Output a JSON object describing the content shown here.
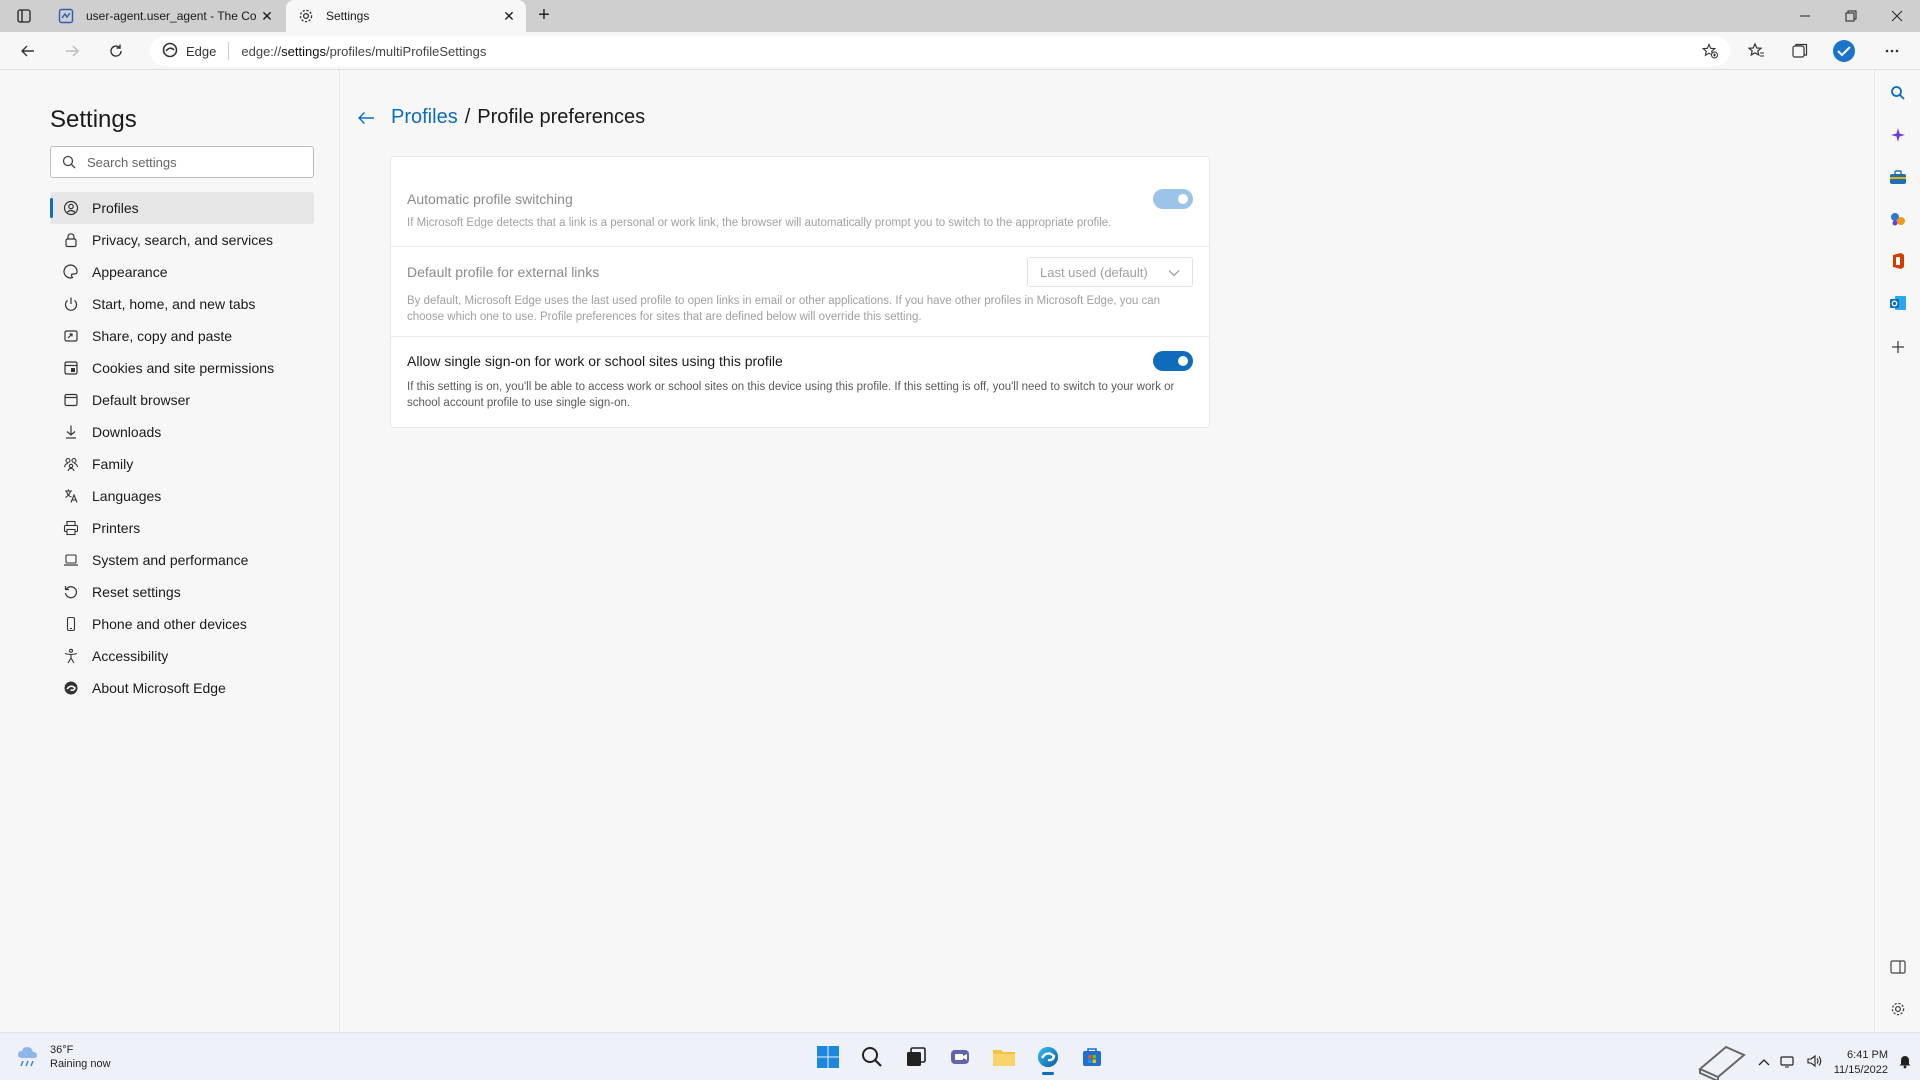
{
  "browser": {
    "tabs": [
      {
        "title": "user-agent.user_agent - The Coll",
        "active": false
      },
      {
        "title": "Settings",
        "active": true
      }
    ],
    "address": {
      "site_label": "Edge",
      "url_prefix": "edge://",
      "url_host": "settings",
      "url_path": "/profiles/multiProfileSettings"
    }
  },
  "sidebar": {
    "title": "Settings",
    "search_placeholder": "Search settings",
    "items": [
      {
        "label": "Profiles",
        "icon": "profile-icon",
        "selected": true
      },
      {
        "label": "Privacy, search, and services",
        "icon": "lock-icon"
      },
      {
        "label": "Appearance",
        "icon": "appearance-icon"
      },
      {
        "label": "Start, home, and new tabs",
        "icon": "power-icon"
      },
      {
        "label": "Share, copy and paste",
        "icon": "share-icon"
      },
      {
        "label": "Cookies and site permissions",
        "icon": "cookies-icon"
      },
      {
        "label": "Default browser",
        "icon": "browser-icon"
      },
      {
        "label": "Downloads",
        "icon": "download-icon"
      },
      {
        "label": "Family",
        "icon": "family-icon"
      },
      {
        "label": "Languages",
        "icon": "language-icon"
      },
      {
        "label": "Printers",
        "icon": "printer-icon"
      },
      {
        "label": "System and performance",
        "icon": "laptop-icon"
      },
      {
        "label": "Reset settings",
        "icon": "reset-icon"
      },
      {
        "label": "Phone and other devices",
        "icon": "phone-icon"
      },
      {
        "label": "Accessibility",
        "icon": "accessibility-icon"
      },
      {
        "label": "About Microsoft Edge",
        "icon": "edge-icon"
      }
    ]
  },
  "page": {
    "breadcrumb_parent": "Profiles",
    "breadcrumb_sep": "/",
    "title": "Profile preferences",
    "settings": [
      {
        "title": "Automatic profile switching",
        "description": "If Microsoft Edge detects that a link is a personal or work link, the browser will automatically prompt you to switch to the appropriate profile.",
        "control": "toggle",
        "on": true,
        "disabled": true
      },
      {
        "title": "Default profile for external links",
        "description": "By default, Microsoft Edge uses the last used profile to open links in email or other applications. If you have other profiles in Microsoft Edge, you can choose which one to use. Profile preferences for sites that are defined below will override this setting.",
        "control": "dropdown",
        "value": "Last used (default)",
        "disabled": true
      },
      {
        "title": "Allow single sign-on for work or school sites using this profile",
        "description": "If this setting is on, you'll be able to access work or school sites on this device using this profile. If this setting is off, you'll need to switch to your work or school account profile to use single sign-on.",
        "control": "toggle",
        "on": true,
        "disabled": false
      }
    ]
  },
  "taskbar": {
    "weather_temp": "36°F",
    "weather_desc": "Raining now",
    "time": "6:41 PM",
    "date": "11/15/2022"
  },
  "colors": {
    "accent": "#0f6cbd"
  }
}
